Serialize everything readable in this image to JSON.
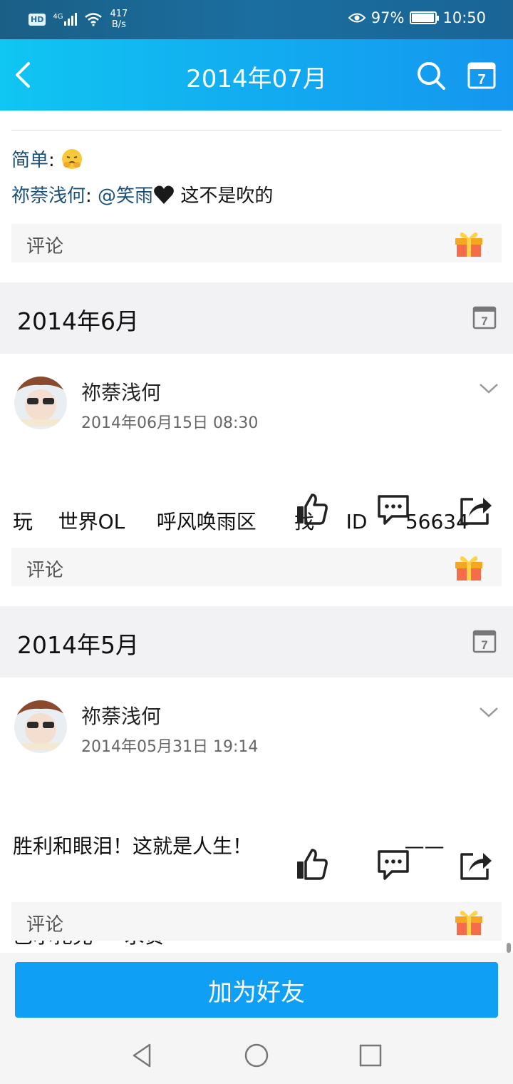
{
  "status_bar": {
    "hd": "HD",
    "network": "4G",
    "speed_value": "417",
    "speed_unit": "B/s",
    "battery_pct": "97%",
    "battery_level": 0.97,
    "time": "10:50"
  },
  "top_bar": {
    "title": "2014年07月",
    "calendar_day": "7"
  },
  "prev_post": {
    "comments": [
      {
        "author": "简单",
        "sep": ":",
        "text": ""
      },
      {
        "author": "祢萘浅何",
        "sep": ":",
        "mention": "@笑雨",
        "text": " 这不是吹的"
      }
    ],
    "comment_label": "评论"
  },
  "months": [
    {
      "title": "2014年6月",
      "calendar_day": "7",
      "post": {
        "author": "祢萘浅何",
        "time": "2014年06月15日 08:30",
        "text_lines": [
          "玩    世界OL     呼风唤雨区      找     ID      56634"
        ],
        "comment_label": "评论"
      }
    },
    {
      "title": "2014年5月",
      "calendar_day": "7",
      "post": {
        "author": "祢萘浅何",
        "time": "2014年05月31日 19:14",
        "text_lines": [
          "胜利和眼泪！这就是人生！                        ——",
          "巴尔扎克     求赞"
        ],
        "comment_label": "评论"
      }
    }
  ],
  "add_friend": "加为好友",
  "icons": {
    "back": "back-arrow-icon",
    "search": "search-icon",
    "calendar": "calendar-icon",
    "gift": "gift-icon",
    "like": "thumbs-up-icon",
    "comment": "comment-bubble-icon",
    "share": "share-icon",
    "chevron": "chevron-down-icon"
  },
  "colors": {
    "accent": "#12aef0",
    "button": "#0fa0f5",
    "link": "#1a4f7a"
  }
}
